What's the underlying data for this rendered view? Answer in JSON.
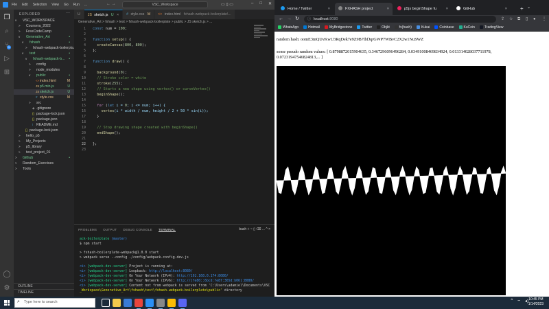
{
  "vscode": {
    "menu": [
      "File",
      "Edit",
      "Selection",
      "View",
      "Go",
      "Run",
      "..."
    ],
    "command_center": "VSC_Workspace",
    "explorer_title": "EXPLORER",
    "tree": [
      {
        "label": "VSC_WORKSPACE",
        "depth": 0,
        "twisty": "v",
        "icon": "",
        "status": ""
      },
      {
        "label": "Coursera_2022",
        "depth": 1,
        "twisty": ">",
        "icon": "",
        "status": ""
      },
      {
        "label": "FreeCodeCamp",
        "depth": 1,
        "twisty": ">",
        "icon": "",
        "status": ""
      },
      {
        "label": "Generative_Art",
        "depth": 1,
        "twisty": "v",
        "icon": "",
        "status": "•"
      },
      {
        "label": "fxhash",
        "depth": 2,
        "twisty": "v",
        "icon": "",
        "status": "•"
      },
      {
        "label": "fxhash-webpack-boilerpla...",
        "depth": 3,
        "twisty": ">",
        "icon": "",
        "status": ""
      },
      {
        "label": "test",
        "depth": 2,
        "twisty": "v",
        "icon": "",
        "status": "•"
      },
      {
        "label": "fxhash-webpack-b...",
        "depth": 3,
        "twisty": "v",
        "icon": "",
        "status": "•"
      },
      {
        "label": "config",
        "depth": 4,
        "twisty": ">",
        "icon": "",
        "status": ""
      },
      {
        "label": "node_modules",
        "depth": 4,
        "twisty": ">",
        "icon": "",
        "status": ""
      },
      {
        "label": "public",
        "depth": 4,
        "twisty": "v",
        "icon": "",
        "status": "•"
      },
      {
        "label": "index.html",
        "depth": 5,
        "twisty": "",
        "icon": "<>",
        "status": "M"
      },
      {
        "label": "p5.min.js",
        "depth": 5,
        "twisty": "",
        "icon": "JS",
        "status": "U"
      },
      {
        "label": "sketch.js",
        "depth": 5,
        "twisty": "",
        "icon": "JS",
        "status": "U"
      },
      {
        "label": "style.css",
        "depth": 5,
        "twisty": "",
        "icon": "#",
        "status": "M"
      },
      {
        "label": "src",
        "depth": 4,
        "twisty": ">",
        "icon": "",
        "status": ""
      },
      {
        "label": ".gitignore",
        "depth": 4,
        "twisty": "",
        "icon": "◆",
        "status": ""
      },
      {
        "label": "package-lock.json",
        "depth": 4,
        "twisty": "",
        "icon": "{}",
        "status": ""
      },
      {
        "label": "package.json",
        "depth": 4,
        "twisty": "",
        "icon": "{}",
        "status": ""
      },
      {
        "label": "README.md",
        "depth": 4,
        "twisty": "",
        "icon": "i",
        "status": ""
      },
      {
        "label": "package-lock.json",
        "depth": 2,
        "twisty": "",
        "icon": "{}",
        "status": ""
      },
      {
        "label": "hello_p5",
        "depth": 1,
        "twisty": ">",
        "icon": "",
        "status": ""
      },
      {
        "label": "My_Projects",
        "depth": 1,
        "twisty": ">",
        "icon": "",
        "status": ""
      },
      {
        "label": "p5_library",
        "depth": 1,
        "twisty": ">",
        "icon": "",
        "status": ""
      },
      {
        "label": "test_project_01",
        "depth": 1,
        "twisty": ">",
        "icon": "",
        "status": ""
      },
      {
        "label": "Github",
        "depth": 0,
        "twisty": ">",
        "icon": "",
        "status": "•"
      },
      {
        "label": "Random_Exercises",
        "depth": 0,
        "twisty": ">",
        "icon": "",
        "status": ""
      },
      {
        "label": "Tools",
        "depth": 0,
        "twisty": ">",
        "icon": "",
        "status": ""
      }
    ],
    "outline": "OUTLINE",
    "timeline": "TIMELINE",
    "tabs": [
      {
        "label": "U",
        "icon": "",
        "status": "",
        "active": false
      },
      {
        "label": "sketch.js",
        "icon": "JS",
        "status": "U",
        "active": true
      },
      {
        "label": "style.css",
        "icon": "#",
        "status": "M",
        "active": false
      },
      {
        "label": "index.html",
        "icon": "<>",
        "status": "fxhash-webpack-boilerplate\\...",
        "active": false
      }
    ],
    "breadcrumb": "Generative_Art > fxhash > test > fxhash-webpack-boilerplate > public > JS sketch.js > ...",
    "line_numbers": [
      "1",
      "2",
      "3",
      "4",
      "5",
      "6",
      "7",
      "8",
      "9",
      "10",
      "11",
      "12",
      "13",
      "14",
      "15",
      "16",
      "17",
      "18",
      "19",
      "20",
      "21",
      "22",
      "23"
    ],
    "code": {
      "l1_decl": "const",
      "l1_rest": " num = ",
      "l1_num": "100",
      "l1_end": ";",
      "l3_kw": "function",
      "l3_fn": " setup",
      "l3_end": "() {",
      "l4_fn": "  createCanvas",
      "l4_open": "(",
      "l4_a": "800",
      "l4_sep": ", ",
      "l4_b": "800",
      "l4_end": ");",
      "l5": "};",
      "l7_kw": "function",
      "l7_fn": " draw",
      "l7_end": "() {",
      "l9_fn": "  background",
      "l9_open": "(",
      "l9_a": "0",
      "l9_end": ");",
      "l10": "  // Stroke color = white",
      "l11_fn": "  stroke",
      "l11_open": "(",
      "l11_a": "255",
      "l11_end": ");",
      "l12": "  // Starts a new shape using vertex() or curveVertex()",
      "l13_fn": "  beginShape",
      "l13_end": "();",
      "l15_kw": "  for",
      "l15_a": " (",
      "l15_let": "let",
      "l15_b": " i = ",
      "l15_n0": "0",
      "l15_c": "; i <= num; i++) {",
      "l16_fn": "    vertex",
      "l16_rest": "(i * width / num, height / 2 + 50 * sin(i));",
      "l17": "  }",
      "l19": "  // Stop drawing shape created with beginShape()",
      "l20_fn": "  endShape",
      "l20_end": "();",
      "l22": "};"
    },
    "panel_tabs": [
      "PROBLEMS",
      "OUTPUT",
      "DEBUG CONSOLE",
      "TERMINAL"
    ],
    "panel_tools": "bash  +  ~  ▯  ⌫  ...  ^  ×",
    "terminal": {
      "prompt_path": "ack-boilerplate",
      "prompt_branch": "(master)",
      "cmd": "$ npm start",
      "l3": "> fxhash-boilerplate-webpack@1.0.0 start",
      "l4": "> webpack serve --config ./config/webpack.config.dev.js",
      "w_tag": "<i>",
      "w_server": "[webpack-dev-server]",
      "w1": " Project is running at:",
      "w2a": " Loopback: ",
      "w2b": "http://localhost:8080/",
      "w3a": " On Your Network (IPv4): ",
      "w3b": "http://192.168.0.174:8080/",
      "w4a": " On Your Network (IPv6): ",
      "w4b": "http://[fe80::6bcd:fe8f:365d:b06]:8080/",
      "w5": " Content not from webpack is served from 'C:\\Users\\adamiel\\Documents\\VSC",
      "w6a": "_Workspace\\Generative_Art\\fxhash\\test\\fxhash-webpack-boilerplate\\public'",
      "w6b": " directory"
    }
  },
  "browser": {
    "tabs": [
      {
        "label": "Home / Twitter",
        "color": "#1d9bf0",
        "active": false
      },
      {
        "label": "FXHASH project",
        "color": "#444444",
        "active": true
      },
      {
        "label": "p5js beginShape fu",
        "color": "#ed225d",
        "active": false
      },
      {
        "label": "GitHub",
        "color": "#ffffff",
        "active": false
      }
    ],
    "url_host": "localhost",
    "url_port": ":8080",
    "bookmarks": [
      {
        "label": "WhatsApp",
        "color": "#25d366"
      },
      {
        "label": "Hotmail",
        "color": "#0078d4"
      },
      {
        "label": "MyBridgestone",
        "color": "#d71920"
      },
      {
        "label": "Twitter",
        "color": "#1d9bf0"
      },
      {
        "label": "Objkt",
        "color": "#222222"
      },
      {
        "label": "fx(hash)",
        "color": "#333333"
      },
      {
        "label": "Kukai",
        "color": "#4a90e2"
      },
      {
        "label": "Coinbase",
        "color": "#0052ff"
      },
      {
        "label": "KuCoin",
        "color": "#24ae8f"
      },
      {
        "label": "TradingView",
        "color": "#131722"
      }
    ],
    "content": {
      "hash_line": "random hash: oomE3mQUvKwU3RqDek7e9Z9B7tbfJqrGWP7WBvC2X2w1NuSWZ",
      "values_line1": "some pseudo random values: [ 0.8798872015904635, 0.3467296096496284, 0.03491008469834924, 0.013314028037711978,",
      "values_line2": "0.07231947546824813,... ]"
    }
  },
  "taskbar": {
    "search_placeholder": "Type here to search",
    "apps": [
      {
        "name": "task-view-icon",
        "color": "#ffffff"
      },
      {
        "name": "file-explorer-icon",
        "color": "#f2c94c"
      },
      {
        "name": "photos-icon",
        "color": "#3a7bd5"
      },
      {
        "name": "chrome-icon",
        "color": "#e8453c"
      },
      {
        "name": "vscode-icon",
        "color": "#2b8ff5"
      },
      {
        "name": "app-icon",
        "color": "#888888"
      },
      {
        "name": "chrome-profile-icon",
        "color": "#fbbc05"
      },
      {
        "name": "discord-icon",
        "color": "#5865f2"
      }
    ],
    "time": "10:45 PM",
    "date": "1/14/2023"
  },
  "colors": {
    "vscode_accent": "#007acc",
    "modified": "#e2c08d",
    "untracked": "#73c991"
  }
}
